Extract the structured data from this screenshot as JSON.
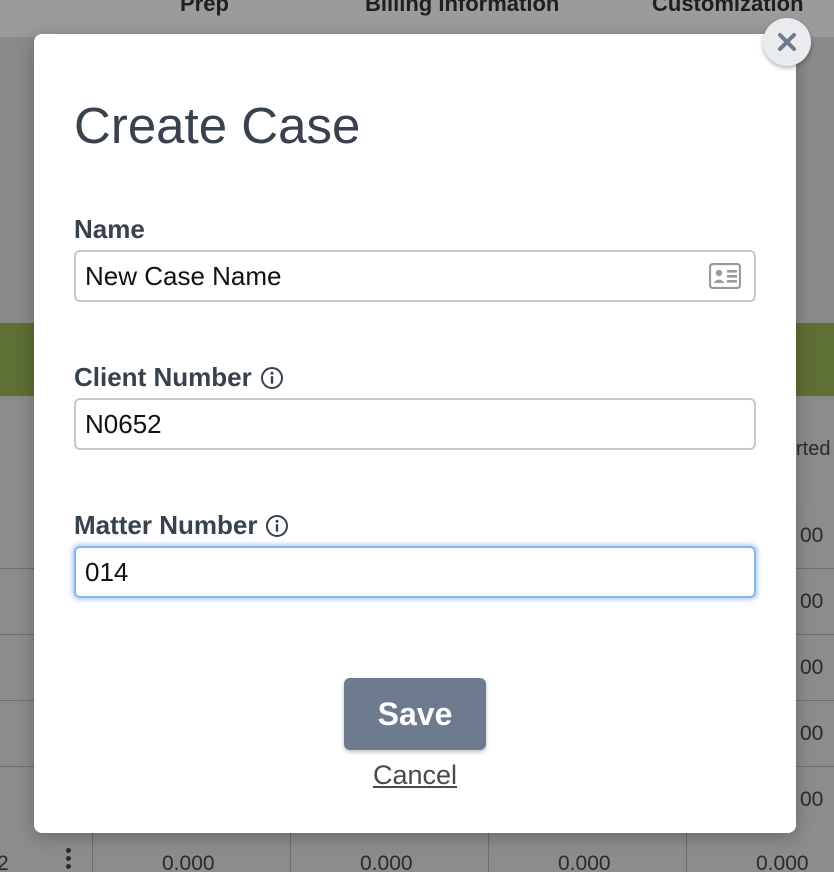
{
  "background": {
    "header_columns": [
      "Prep",
      "Billing Information",
      "Customization"
    ],
    "column_header_partial": "rted",
    "row_values": [
      "00",
      "00",
      "00",
      "00",
      "00"
    ],
    "last_row": {
      "first_cell": "2",
      "values": [
        "0.000",
        "0.000",
        "0.000",
        "0.000"
      ]
    }
  },
  "modal": {
    "title": "Create Case",
    "fields": {
      "name": {
        "label": "Name",
        "value": "New Case Name"
      },
      "client_number": {
        "label": "Client Number",
        "value": "N0652"
      },
      "matter_number": {
        "label": "Matter Number",
        "value": "014"
      }
    },
    "save_label": "Save",
    "cancel_label": "Cancel"
  },
  "colors": {
    "title_text": "#38414e",
    "save_button": "#6e7a8e",
    "focus_ring": "#86b7ec",
    "background_green_band": "#5e6f34"
  },
  "icons": {
    "close": "close-icon",
    "contact_card": "contact-card-icon",
    "info": "info-icon"
  }
}
